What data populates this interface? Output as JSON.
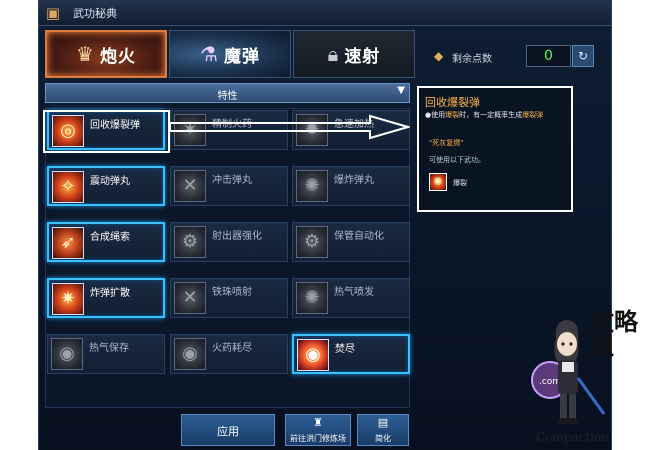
{
  "window": {
    "title": "武功秘典",
    "book_icon": "book-icon"
  },
  "tabs": [
    {
      "label": "炮火",
      "icon": "fire-crown-icon",
      "active": true
    },
    {
      "label": "魔弹",
      "icon": "magic-bottle-icon",
      "active": false
    },
    {
      "label": "速射",
      "icon": "lock-icon",
      "active": false
    }
  ],
  "points": {
    "label": "剩余点数",
    "value": "0",
    "reset_icon": "refresh-icon"
  },
  "trait_header": {
    "label": "特性",
    "arrow": "▼"
  },
  "skills": [
    {
      "name": "回收爆裂弹",
      "active": true,
      "glyph": "◎"
    },
    {
      "name": "精制火药",
      "active": false,
      "glyph": "✶"
    },
    {
      "name": "急速加热",
      "active": false,
      "glyph": "✹"
    },
    {
      "name": "震动弹丸",
      "active": true,
      "glyph": "✧"
    },
    {
      "name": "冲击弹丸",
      "active": false,
      "glyph": "✕"
    },
    {
      "name": "爆炸弹丸",
      "active": false,
      "glyph": "✺"
    },
    {
      "name": "合成绳索",
      "active": true,
      "glyph": "➶"
    },
    {
      "name": "射出器强化",
      "active": false,
      "glyph": "⚙"
    },
    {
      "name": "保管自动化",
      "active": false,
      "glyph": "⚙"
    },
    {
      "name": "炸弹扩散",
      "active": true,
      "glyph": "✷"
    },
    {
      "name": "铁珠喷射",
      "active": false,
      "glyph": "✕"
    },
    {
      "name": "热气喷发",
      "active": false,
      "glyph": "✺"
    },
    {
      "name": "热气保存",
      "active": false,
      "glyph": "◉"
    },
    {
      "name": "火药耗尽",
      "active": false,
      "glyph": "◉"
    },
    {
      "name": "焚尽",
      "active": true,
      "glyph": "◉"
    }
  ],
  "tooltip": {
    "title": "回收爆裂弹",
    "desc_prefix": "●使用",
    "desc_hl1": "爆裂",
    "desc_mid": "时，有一定概率生成",
    "desc_hl2": "爆裂弹",
    "quote": "\"死灰复燃\"",
    "usable": "可使用以下武功。",
    "skill_name": "爆裂"
  },
  "buttons": {
    "apply": "应用",
    "training": "前往洪门修炼场",
    "simplify": "简化"
  },
  "branding": {
    "cn": "攻略组",
    "en": "Compaction",
    "badge": ".com"
  },
  "colors": {
    "accent": "#39c0ff",
    "fire_tab": "#e07a3a",
    "points": "#4cff5a",
    "tooltip_title": "#ffb347"
  }
}
